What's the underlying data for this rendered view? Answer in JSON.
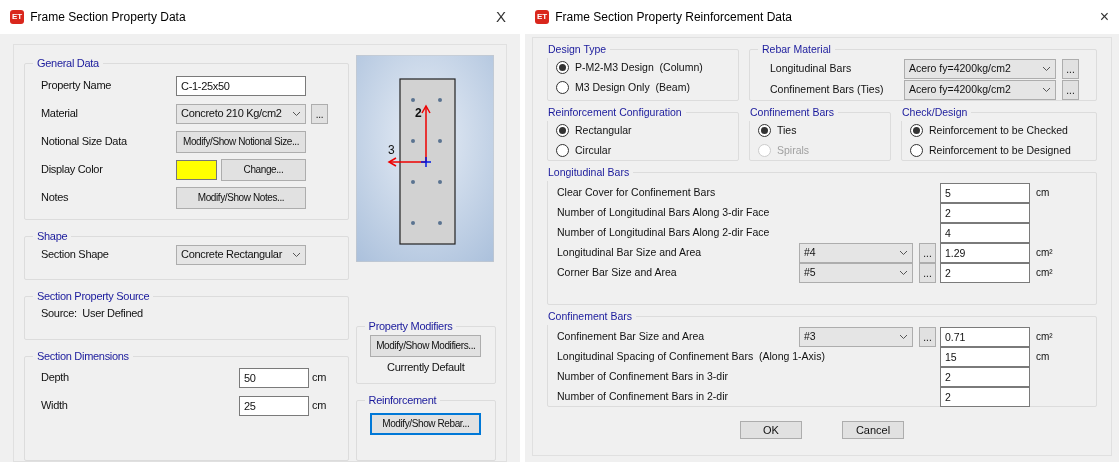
{
  "left_dialog": {
    "app_icon": "ET",
    "title": "Frame Section Property Data",
    "close": "X",
    "general_data": {
      "title": "General Data",
      "rows": [
        {
          "kind": "field",
          "label": "Property Name",
          "value": "C-1-25x50"
        },
        {
          "kind": "dropdown",
          "label": "Material",
          "value": "Concreto 210 Kg/cm2",
          "more": "..."
        },
        {
          "kind": "button",
          "label": "Notional Size Data",
          "button": "Modify/Show Notional Size..."
        },
        {
          "kind": "color",
          "label": "Display Color",
          "color": "#ffff00",
          "button": "Change..."
        },
        {
          "kind": "button",
          "label": "Notes",
          "button": "Modify/Show Notes..."
        }
      ]
    },
    "section_preview": {
      "axis_2": "2",
      "axis_3": "3"
    },
    "shape": {
      "title": "Shape",
      "label": "Section Shape",
      "value": "Concrete Rectangular"
    },
    "source": {
      "title": "Section Property Source",
      "text": "Source:  User Defined"
    },
    "dimensions": {
      "title": "Section Dimensions",
      "rows": [
        {
          "label": "Depth",
          "value": "50",
          "unit": "cm"
        },
        {
          "label": "Width",
          "value": "25",
          "unit": "cm"
        }
      ]
    },
    "property_modifiers": {
      "title": "Property Modifiers",
      "button": "Modify/Show Modifiers...",
      "status": "Currently Default"
    },
    "reinforcement": {
      "title": "Reinforcement",
      "button": "Modify/Show Rebar...",
      "focused": true
    }
  },
  "right_dialog": {
    "app_icon": "ET",
    "title": "Frame Section Property Reinforcement Data",
    "close": "×",
    "design_type": {
      "title": "Design Type",
      "options": [
        {
          "label": "P-M2-M3 Design  (Column)",
          "selected": true,
          "disabled": false
        },
        {
          "label": "M3 Design Only  (Beam)",
          "selected": false,
          "disabled": false
        }
      ]
    },
    "rebar_material": {
      "title": "Rebar Material",
      "rows": [
        {
          "label": "Longitudinal Bars",
          "value": "Acero fy=4200kg/cm2",
          "more": "..."
        },
        {
          "label": "Confinement Bars (Ties)",
          "value": "Acero fy=4200kg/cm2",
          "more": "..."
        }
      ]
    },
    "reinforcement_configuration": {
      "title": "Reinforcement Configuration",
      "options": [
        {
          "label": "Rectangular",
          "selected": true,
          "disabled": false
        },
        {
          "label": "Circular",
          "selected": false,
          "disabled": false
        }
      ]
    },
    "confinement_type": {
      "title": "Confinement Bars",
      "options": [
        {
          "label": "Ties",
          "selected": true,
          "disabled": false
        },
        {
          "label": "Spirals",
          "selected": false,
          "disabled": true
        }
      ]
    },
    "check_design": {
      "title": "Check/Design",
      "options": [
        {
          "label": "Reinforcement to be Checked",
          "selected": true,
          "disabled": false
        },
        {
          "label": "Reinforcement to be Designed",
          "selected": false,
          "disabled": false
        }
      ]
    },
    "longitudinal_bars": {
      "title": "Longitudinal Bars",
      "rows": [
        {
          "kind": "field",
          "label": "Clear Cover for Confinement Bars",
          "value": "5",
          "unit": "cm"
        },
        {
          "kind": "field",
          "label": "Number of Longitudinal Bars Along 3-dir Face",
          "value": "2"
        },
        {
          "kind": "field",
          "label": "Number of Longitudinal Bars Along 2-dir Face",
          "value": "4"
        },
        {
          "kind": "size",
          "label": "Longitudinal Bar Size and Area",
          "size": "#4",
          "more": "...",
          "value": "1.29",
          "unit": "cm²"
        },
        {
          "kind": "size",
          "label": "Corner Bar Size and Area",
          "size": "#5",
          "more": "...",
          "value": "2",
          "unit": "cm²"
        }
      ]
    },
    "confinement_bars": {
      "title": "Confinement Bars",
      "rows": [
        {
          "kind": "size",
          "label": "Confinement Bar Size and Area",
          "size": "#3",
          "more": "...",
          "value": "0.71",
          "unit": "cm²"
        },
        {
          "kind": "field",
          "label": "Longitudinal Spacing of Confinement Bars  (Along 1-Axis)",
          "value": "15",
          "unit": "cm"
        },
        {
          "kind": "field",
          "label": "Number of Confinement Bars in 3-dir",
          "value": "2"
        },
        {
          "kind": "field",
          "label": "Number of Confinement Bars in 2-dir",
          "value": "2"
        }
      ]
    },
    "buttons": [
      "OK",
      "Cancel"
    ]
  }
}
